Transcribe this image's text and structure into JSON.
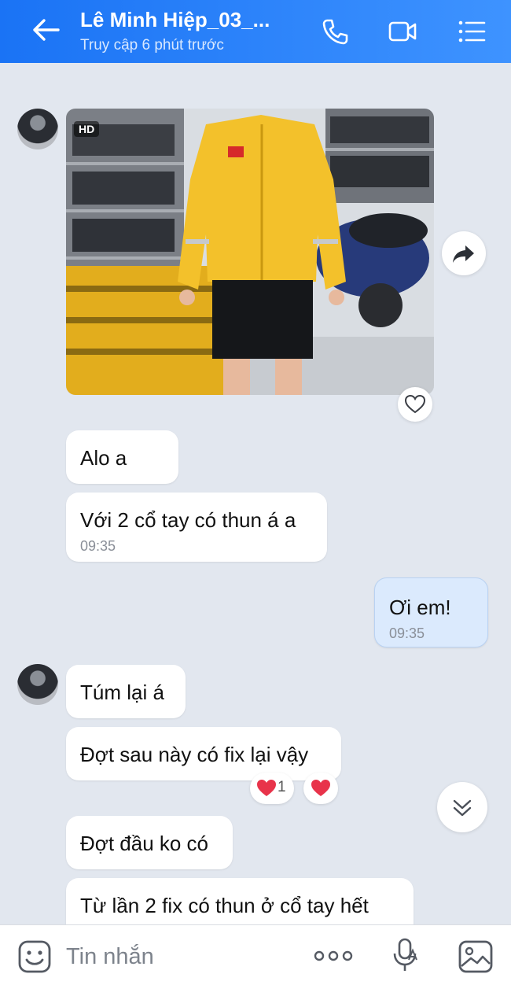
{
  "header": {
    "contact_name": "Lê Minh Hiệp_03_...",
    "status": "Truy cập 6 phút trước"
  },
  "messages": {
    "photo_badge": "HD",
    "m1": "Alo a",
    "m2": "Với 2 cổ tay có thun á a",
    "m2_time": "09:35",
    "m3": "Ơi em!",
    "m3_time": "09:35",
    "m4": "Túm lại á",
    "m5": "Đợt sau này có fix lại vậy",
    "m5_reaction_count": "1",
    "m6": "Đợt đầu ko có",
    "m7": "Từ lần 2 fix có thun ở cổ tay hết"
  },
  "input": {
    "placeholder": "Tin nhắn"
  },
  "colors": {
    "header_start": "#1a73f5",
    "header_end": "#3e93ff",
    "chat_bg": "#e2e7ef",
    "my_bubble": "#dbeafd",
    "heart": "#e8334a",
    "jacket_yellow": "#f3c12b"
  },
  "icons": [
    "back-arrow-icon",
    "phone-icon",
    "video-call-icon",
    "menu-icon",
    "share-icon",
    "heart-outline-icon",
    "heart-icon",
    "scroll-down-icon",
    "emoji-icon",
    "more-icon",
    "voice-to-text-icon",
    "image-icon"
  ]
}
